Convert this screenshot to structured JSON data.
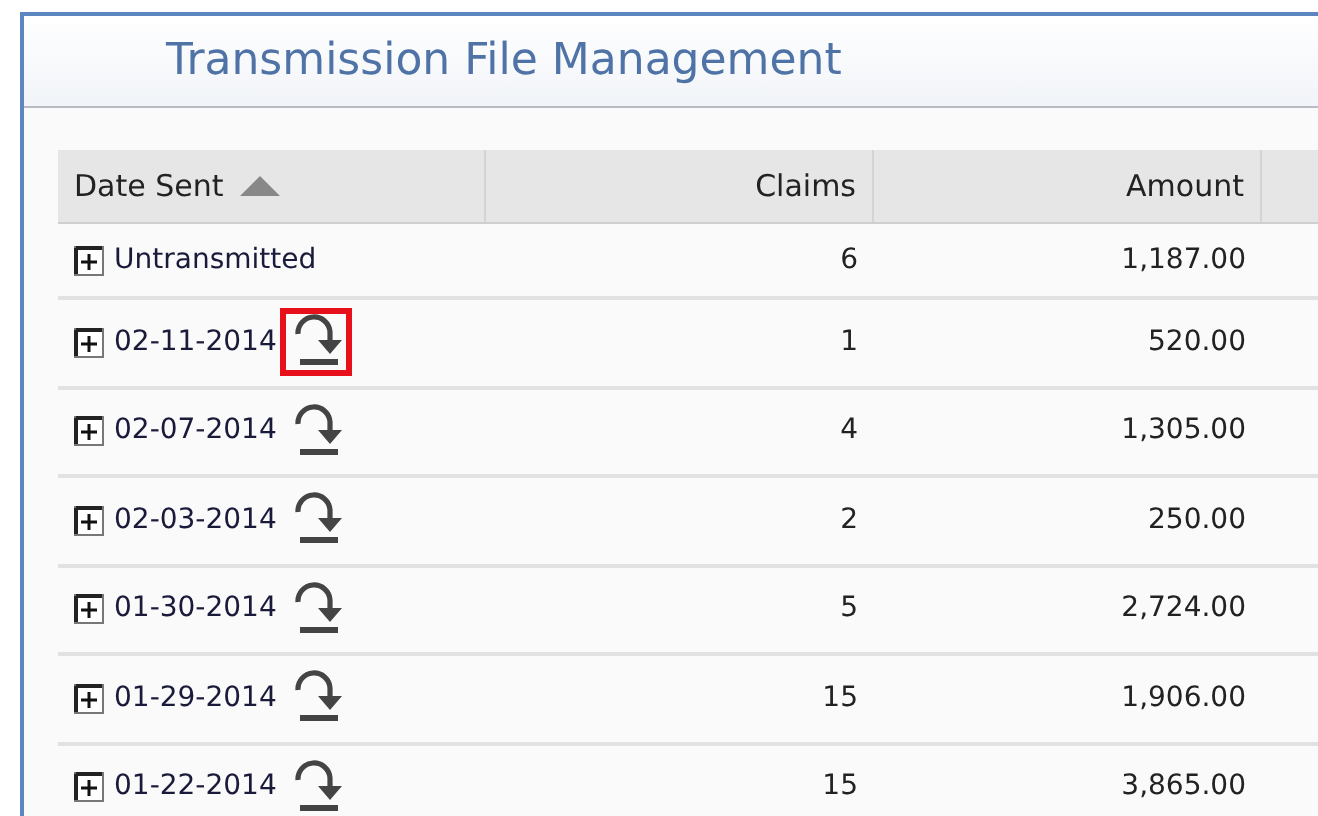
{
  "panel": {
    "title": "Transmission File Management"
  },
  "table": {
    "columns": [
      {
        "label": "Date Sent",
        "sorted": true
      },
      {
        "label": "Claims"
      },
      {
        "label": "Amount"
      }
    ],
    "rows": [
      {
        "date_sent": "Untransmitted",
        "claims": "6",
        "amount": "1,187.00",
        "download": false
      },
      {
        "date_sent": "02-11-2014",
        "claims": "1",
        "amount": "520.00",
        "download": true,
        "highlighted": true
      },
      {
        "date_sent": "02-07-2014",
        "claims": "4",
        "amount": "1,305.00",
        "download": true,
        "highlighted": false
      },
      {
        "date_sent": "02-03-2014",
        "claims": "2",
        "amount": "250.00",
        "download": true,
        "highlighted": false
      },
      {
        "date_sent": "01-30-2014",
        "claims": "5",
        "amount": "2,724.00",
        "download": true,
        "highlighted": false
      },
      {
        "date_sent": "01-29-2014",
        "claims": "15",
        "amount": "1,906.00",
        "download": true,
        "highlighted": false
      },
      {
        "date_sent": "01-22-2014",
        "claims": "15",
        "amount": "3,865.00",
        "download": true,
        "highlighted": false
      }
    ]
  }
}
